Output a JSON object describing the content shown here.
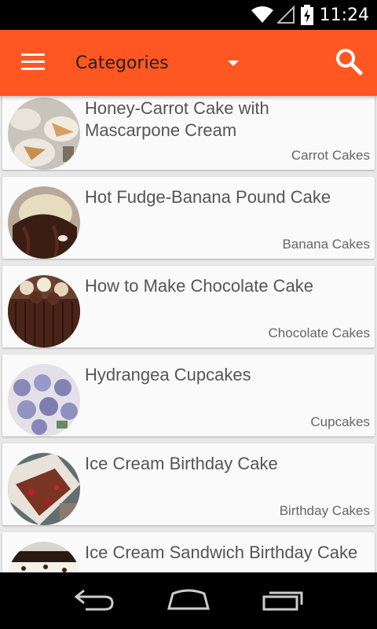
{
  "status_bar": {
    "time": "11:24"
  },
  "app_bar": {
    "category_label": "Categories",
    "accent_color": "#ff5722"
  },
  "recipes": [
    {
      "title": "Honey-Carrot Cake with Mascarpone Cream",
      "category": "Carrot Cakes",
      "thumb": "carrot-cake-photo"
    },
    {
      "title": "Hot Fudge-Banana Pound Cake",
      "category": "Banana Cakes",
      "thumb": "banana-cake-photo"
    },
    {
      "title": "How to Make Chocolate Cake",
      "category": "Chocolate Cakes",
      "thumb": "chocolate-cake-photo"
    },
    {
      "title": "Hydrangea Cupcakes",
      "category": "Cupcakes",
      "thumb": "cupcakes-photo"
    },
    {
      "title": "Ice Cream Birthday Cake",
      "category": "Birthday Cakes",
      "thumb": "ice-cream-cake-photo"
    },
    {
      "title": "Ice Cream Sandwich Birthday Cake",
      "category": "",
      "thumb": "ice-cream-sandwich-cake-photo"
    }
  ],
  "nav_bar": {
    "buttons": [
      "back-icon",
      "home-icon",
      "recent-apps-icon"
    ]
  }
}
